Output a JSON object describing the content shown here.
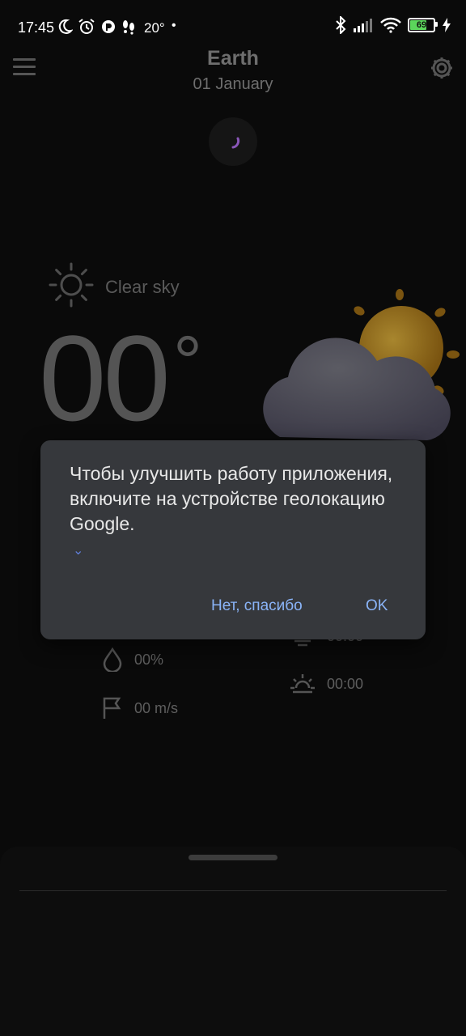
{
  "status_bar": {
    "time": "17:45",
    "temperature": "20°",
    "battery": "69"
  },
  "header": {
    "title": "Earth",
    "date": "01 January"
  },
  "weather": {
    "condition": "Clear sky",
    "temperature": "00",
    "unit": "°"
  },
  "details": {
    "humidity": "00%",
    "wind": "00 m/s",
    "sunset_partial": "00:00",
    "sunrise": "00:00"
  },
  "dialog": {
    "message": "Чтобы улучшить работу приложения, включите на устройстве геолокацию Google.",
    "no_label": "Нет, спасибо",
    "ok_label": "OK"
  },
  "colors": {
    "dialog_bg": "#36383c",
    "accent": "#8ab4f8",
    "battery": "#5bd65b"
  }
}
